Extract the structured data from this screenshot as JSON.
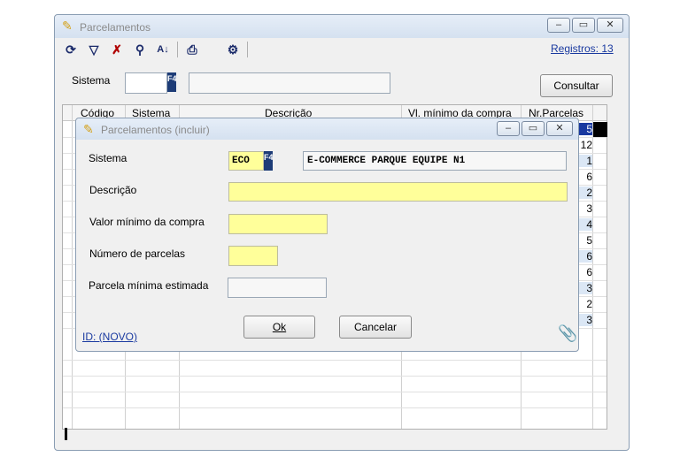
{
  "main_window": {
    "title": "Parcelamentos",
    "registros": "Registros: 13",
    "sistema_label": "Sistema",
    "f4_label": "F4",
    "consultar_label": "Consultar",
    "toolbar_icons": [
      "refresh-icon",
      "filter-icon",
      "clear-filter-icon",
      "search-icon",
      "sort-az-icon",
      "print-icon",
      "settings-icon"
    ]
  },
  "grid": {
    "columns": [
      "Código",
      "Sistema",
      "Descrição",
      "Vl. mínimo da compra",
      "Nr.Parcelas"
    ],
    "parcelas": [
      "5",
      "12",
      "1",
      "6",
      "2",
      "3",
      "4",
      "5",
      "6",
      "6",
      "3",
      "2",
      "3"
    ]
  },
  "dialog": {
    "title": "Parcelamentos (incluir)",
    "sistema_label": "Sistema",
    "sistema_value": "ECO",
    "f4_label": "F4",
    "sistema_desc": "E-COMMERCE PARQUE EQUIPE N1",
    "descricao_label": "Descrição",
    "valor_label": "Valor mínimo da compra",
    "numero_label": "Número de parcelas",
    "parcela_label": "Parcela mínima estimada",
    "ok_label": "Ok",
    "cancelar_label": "Cancelar",
    "id_label": "ID: (NOVO)"
  },
  "colors": {
    "highlight_blue": "#1a3aa0",
    "field_yellow": "#ffff9a"
  }
}
